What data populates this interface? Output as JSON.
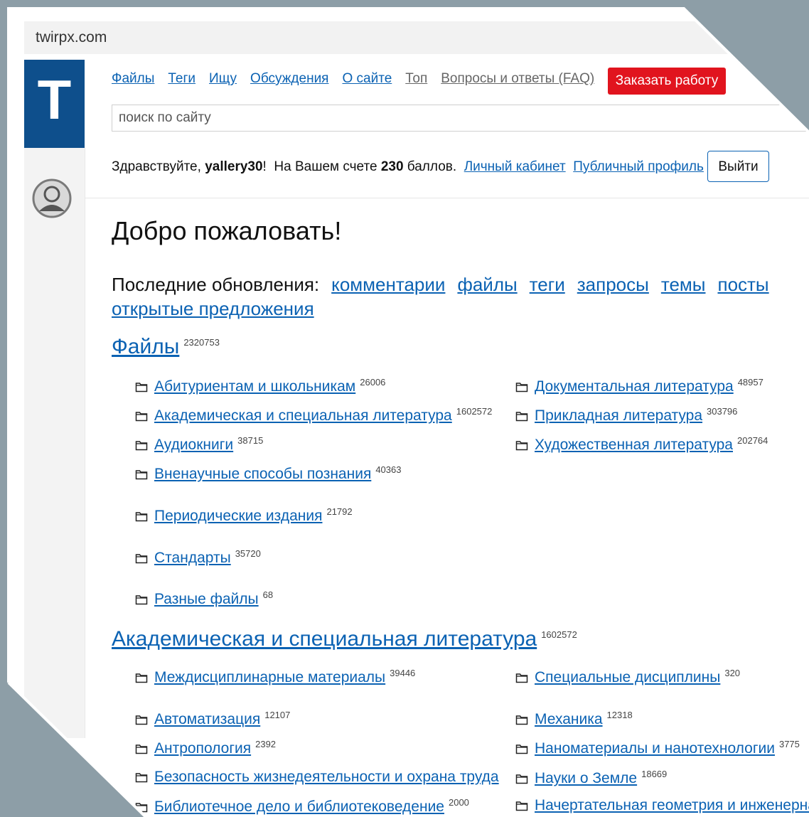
{
  "browser": {
    "url": "twirpx.com"
  },
  "logo": {
    "letter": "T"
  },
  "nav": {
    "links": [
      "Файлы",
      "Теги",
      "Ищу",
      "Обсуждения",
      "О сайте",
      "Топ",
      "Вопросы и ответы (FAQ)"
    ],
    "order_button": "Заказать работу"
  },
  "search": {
    "placeholder": "поиск по сайту"
  },
  "user": {
    "greeting": "Здравствуйте,",
    "username": "yallery30",
    "exclaim": "!",
    "balance_prefix": "На Вашем счете",
    "balance": "230",
    "balance_suffix": "баллов.",
    "cabinet_link": "Личный кабинет",
    "profile_link": "Публичный профиль",
    "logout": "Выйти"
  },
  "page": {
    "title": "Добро пожаловать!"
  },
  "updates": {
    "label": "Последние обновления:",
    "links": [
      "комментарии",
      "файлы",
      "теги",
      "запросы",
      "темы",
      "посты",
      "открытые предложения"
    ]
  },
  "files_section": {
    "title": "Файлы",
    "count": "2320753",
    "left": [
      {
        "label": "Абитуриентам и школьникам",
        "count": "26006"
      },
      {
        "label": "Академическая и специальная литература",
        "count": "1602572"
      },
      {
        "label": "Аудиокниги",
        "count": "38715"
      },
      {
        "label": "Вненаучные способы познания",
        "count": "40363"
      },
      {
        "label": "Периодические издания",
        "count": "21792"
      },
      {
        "label": "Стандарты",
        "count": "35720"
      },
      {
        "label": "Разные файлы",
        "count": "68"
      }
    ],
    "right": [
      {
        "label": "Документальная литература",
        "count": "48957"
      },
      {
        "label": "Прикладная литература",
        "count": "303796"
      },
      {
        "label": "Художественная литература",
        "count": "202764"
      }
    ]
  },
  "academic_section": {
    "title": "Академическая и специальная литература",
    "count": "1602572",
    "left": [
      {
        "label": "Междисциплинарные материалы",
        "count": "39446"
      },
      {
        "label": "Автоматизация",
        "count": "12107"
      },
      {
        "label": "Антропология",
        "count": "2392"
      },
      {
        "label": "Безопасность жизнедеятельности и охрана труда",
        "count": ""
      },
      {
        "label": "Библиотечное дело и библиотековедение",
        "count": "2000"
      }
    ],
    "right": [
      {
        "label": "Специальные дисциплины",
        "count": "320"
      },
      {
        "label": "Механика",
        "count": "12318"
      },
      {
        "label": "Наноматериалы и нанотехнологии",
        "count": "3775"
      },
      {
        "label": "Науки о Земле",
        "count": "18669"
      },
      {
        "label": "Начертательная геометрия и инженерная",
        "count": ""
      }
    ]
  },
  "colors": {
    "link": "#0b62b3",
    "brand": "#0e4f8c",
    "accent_button": "#e1141e",
    "backdrop": "#8d9ea7"
  },
  "icons": {
    "folder": "folder-icon",
    "avatar": "user-avatar-icon"
  }
}
